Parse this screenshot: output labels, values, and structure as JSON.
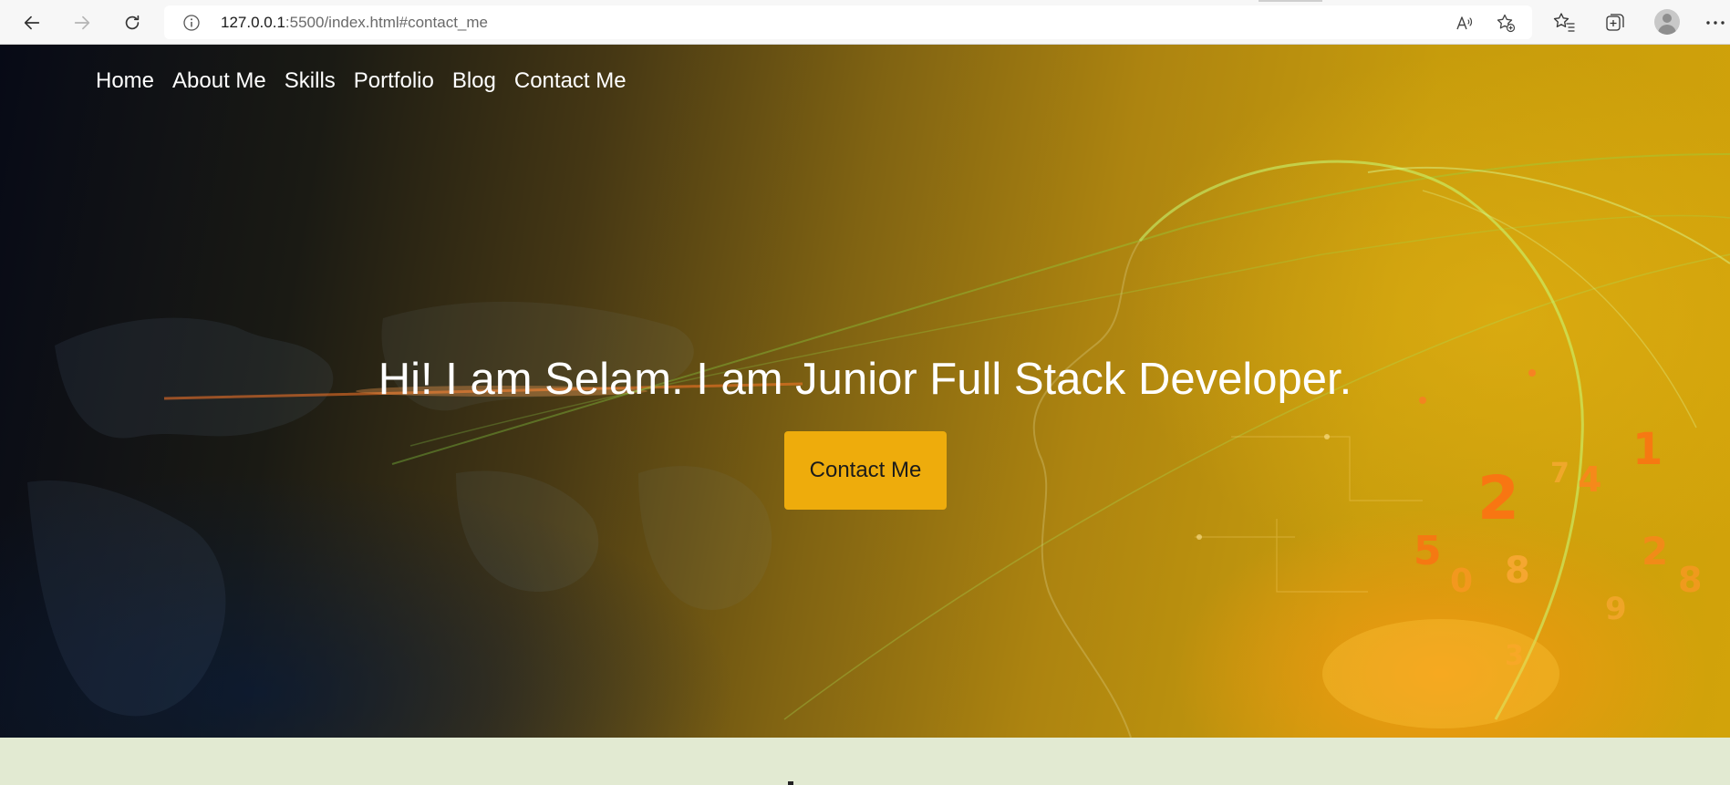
{
  "browser": {
    "address": {
      "host": "127.0.0.1",
      "rest": ":5500/index.html#contact_me"
    },
    "icons": {
      "back": "back-arrow-icon",
      "forward": "forward-arrow-icon",
      "reload": "reload-icon",
      "site_info": "info-icon",
      "read_aloud": "read-aloud-icon",
      "add_favorite": "star-add-icon",
      "favorites": "favorites-list-icon",
      "collections": "collections-icon",
      "profile": "profile-avatar-icon",
      "menu": "more-menu-icon"
    }
  },
  "nav": {
    "items": [
      {
        "label": "Home"
      },
      {
        "label": "About Me"
      },
      {
        "label": "Skills"
      },
      {
        "label": "Portfolio"
      },
      {
        "label": "Blog"
      },
      {
        "label": "Contact Me"
      }
    ]
  },
  "hero": {
    "headline": "Hi! I am Selam. I am Junior Full Stack Developer.",
    "cta_label": "Contact Me"
  },
  "colors": {
    "cta_background": "#eeac0c",
    "next_section_background": "#e2ead2",
    "nav_text": "#ffffff"
  }
}
